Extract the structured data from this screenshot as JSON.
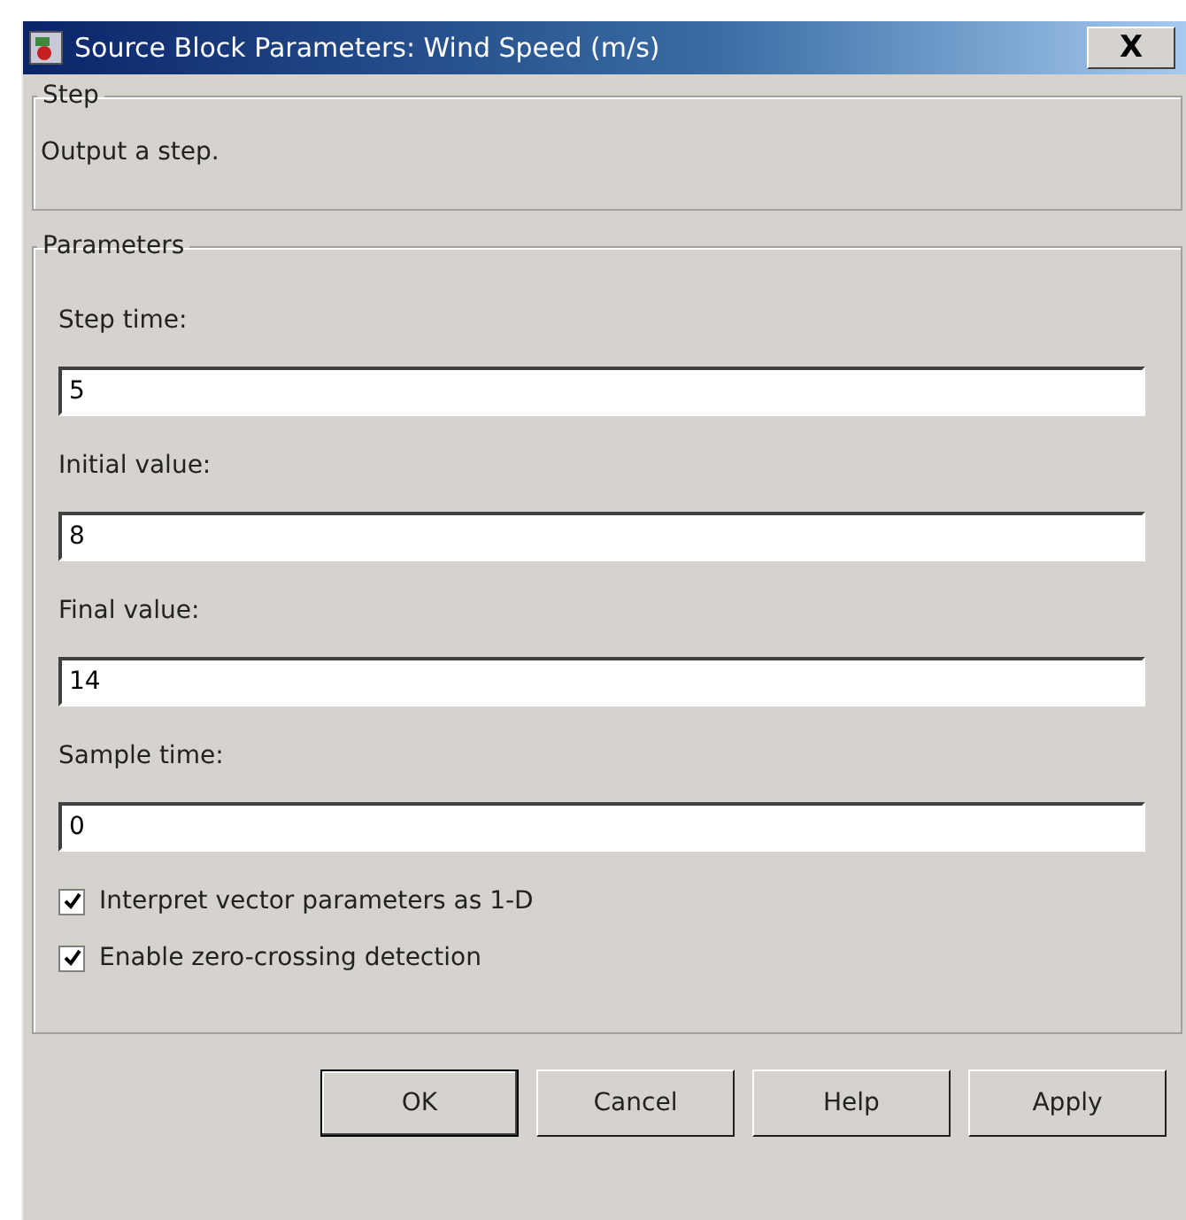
{
  "window": {
    "title": "Source Block Parameters: Wind Speed (m/s)",
    "close": "X"
  },
  "step_group": {
    "title": "Step",
    "description": "Output a step."
  },
  "parameters_group": {
    "title": "Parameters",
    "fields": [
      {
        "label": "Step time:",
        "value": "5"
      },
      {
        "label": "Initial value:",
        "value": "8"
      },
      {
        "label": "Final value:",
        "value": "14"
      },
      {
        "label": "Sample time:",
        "value": "0"
      }
    ],
    "checkboxes": [
      {
        "label": "Interpret vector parameters as 1-D",
        "checked": true
      },
      {
        "label": "Enable zero-crossing detection",
        "checked": true
      }
    ]
  },
  "buttons": [
    {
      "label": "OK",
      "selected": true
    },
    {
      "label": "Cancel",
      "selected": false
    },
    {
      "label": "Help",
      "selected": false
    },
    {
      "label": "Apply",
      "selected": false
    }
  ]
}
